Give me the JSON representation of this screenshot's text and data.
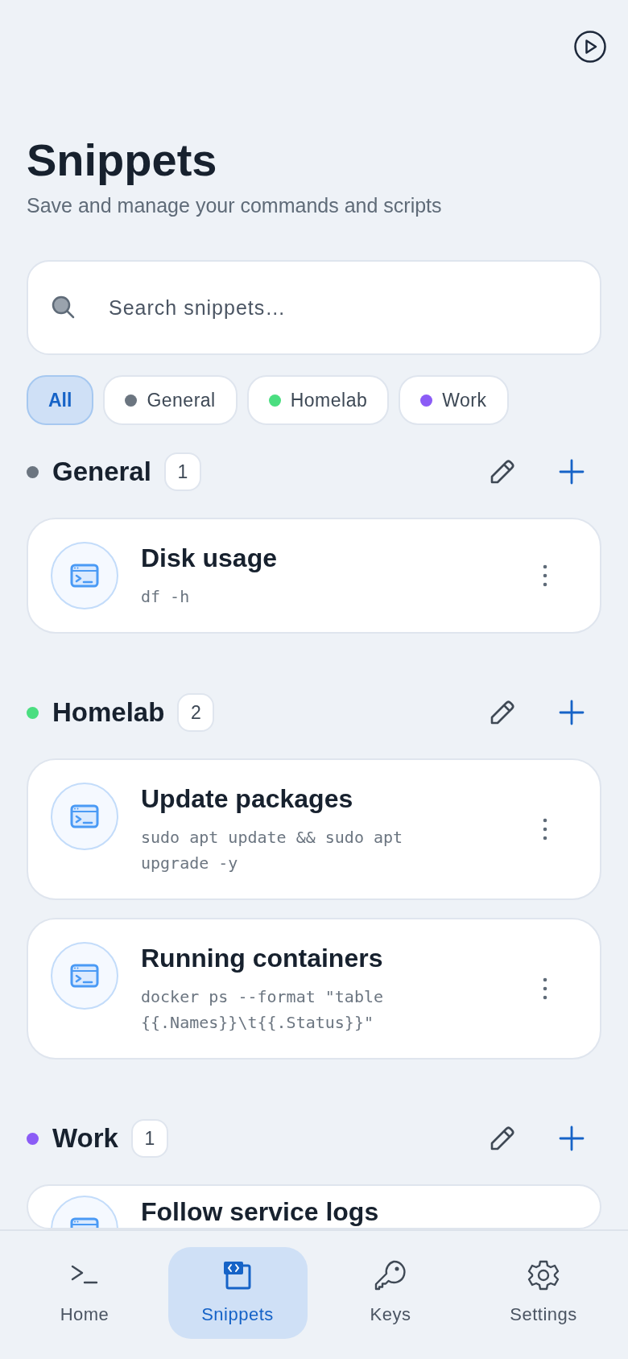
{
  "header": {
    "title": "Snippets",
    "subtitle": "Save and manage your commands and scripts"
  },
  "search": {
    "placeholder": "Search snippets…"
  },
  "filters": [
    {
      "label": "All",
      "selected": true
    },
    {
      "label": "General",
      "color": "#6b7580",
      "selected": false
    },
    {
      "label": "Homelab",
      "color": "#4ade80",
      "selected": false
    },
    {
      "label": "Work",
      "color": "#8b5cf6",
      "selected": false
    }
  ],
  "groups": [
    {
      "name": "General",
      "color": "#6b7580",
      "count": "1",
      "snippets": [
        {
          "title": "Disk usage",
          "command": "df -h"
        }
      ]
    },
    {
      "name": "Homelab",
      "color": "#4ade80",
      "count": "2",
      "snippets": [
        {
          "title": "Update packages",
          "command": "sudo apt update && sudo apt upgrade -y"
        },
        {
          "title": "Running containers",
          "command": "docker ps --format \"table {{.Names}}\\t{{.Status}}\""
        }
      ]
    },
    {
      "name": "Work",
      "color": "#8b5cf6",
      "count": "1",
      "snippets": [
        {
          "title": "Follow service logs"
        }
      ]
    }
  ],
  "nav": [
    {
      "label": "Home",
      "selected": false
    },
    {
      "label": "Snippets",
      "selected": true
    },
    {
      "label": "Keys",
      "selected": false
    },
    {
      "label": "Settings",
      "selected": false
    }
  ]
}
